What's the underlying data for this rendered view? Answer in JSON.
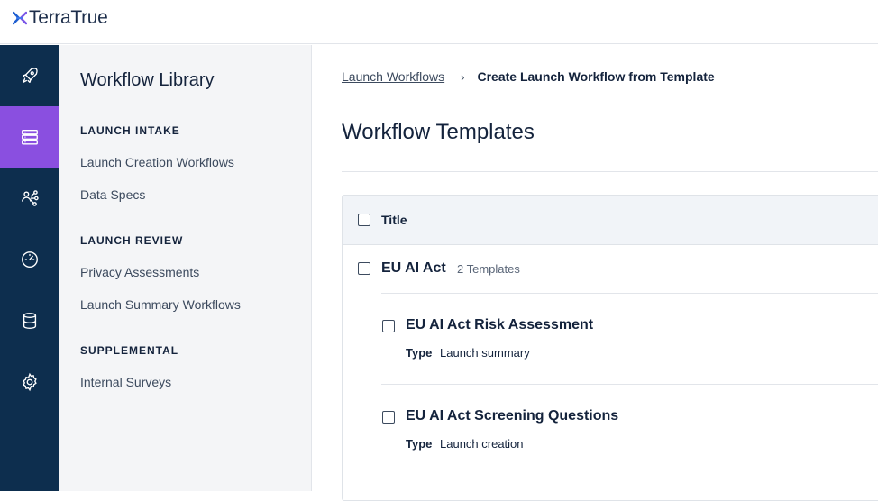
{
  "app": {
    "logo_text": "TerraTrue",
    "logo_icon": "terratrue-x-icon"
  },
  "icon_rail": {
    "items": [
      {
        "name": "rocket-icon",
        "active": false
      },
      {
        "name": "library-stack-icon",
        "active": true
      },
      {
        "name": "workflow-share-icon",
        "active": false
      },
      {
        "name": "gauge-icon",
        "active": false
      },
      {
        "name": "database-icon",
        "active": false
      },
      {
        "name": "gear-icon",
        "active": false
      }
    ],
    "active_color": "#8a4fe0",
    "background_color": "#0d2e4e"
  },
  "sidebar": {
    "title": "Workflow Library",
    "sections": [
      {
        "heading": "LAUNCH INTAKE",
        "links": [
          "Launch Creation Workflows",
          "Data Specs"
        ]
      },
      {
        "heading": "LAUNCH REVIEW",
        "links": [
          "Privacy Assessments",
          "Launch Summary Workflows"
        ]
      },
      {
        "heading": "SUPPLEMENTAL",
        "links": [
          "Internal Surveys"
        ]
      }
    ]
  },
  "breadcrumb": {
    "parent": "Launch Workflows",
    "separator": "›",
    "current": "Create Launch Workflow from Template"
  },
  "page": {
    "title": "Workflow Templates"
  },
  "table": {
    "header_title": "Title",
    "group": {
      "name": "EU AI Act",
      "count_label": "2 Templates",
      "items": [
        {
          "title": "EU AI Act Risk Assessment",
          "type_label": "Type",
          "type_value": "Launch summary"
        },
        {
          "title": "EU AI Act Screening Questions",
          "type_label": "Type",
          "type_value": "Launch creation"
        }
      ]
    }
  }
}
